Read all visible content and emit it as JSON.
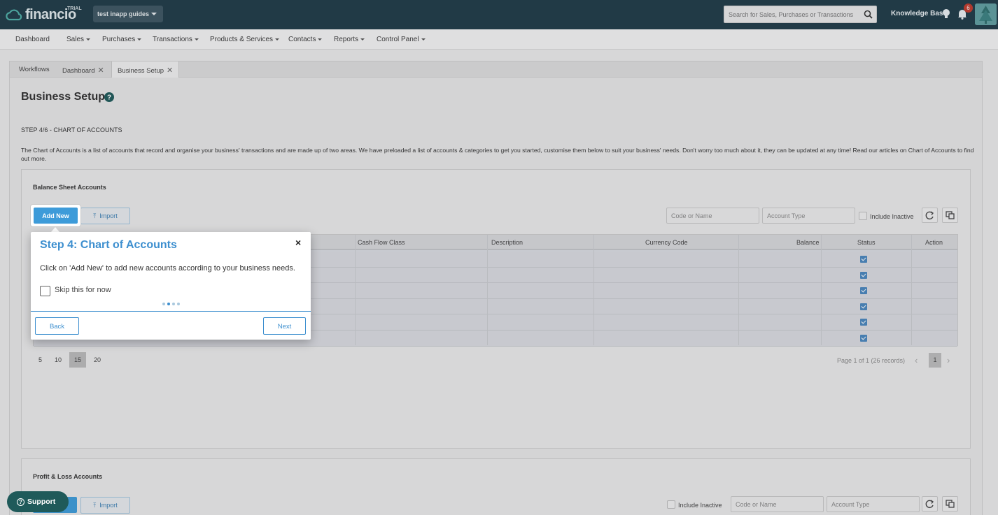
{
  "brand": {
    "logo_text": "financio",
    "trial_label": "TRIAL"
  },
  "org": {
    "name": "test inapp guides"
  },
  "search": {
    "placeholder": "Search for Sales, Purchases or Transactions"
  },
  "top_right": {
    "knowledge_base": "Knowledge Base",
    "notification_count": "6"
  },
  "nav": [
    "Dashboard",
    "Sales",
    "Purchases",
    "Transactions",
    "Products & Services",
    "Contacts",
    "Reports",
    "Control Panel"
  ],
  "tabs": [
    {
      "label": "Workflows",
      "closable": false
    },
    {
      "label": "Dashboard",
      "closable": true
    },
    {
      "label": "Business Setup",
      "closable": true
    }
  ],
  "page": {
    "title": "Business Setup",
    "step": "STEP 4/6 - CHART OF ACCOUNTS",
    "description": "The Chart of Accounts is a list of accounts that record and organise your business' transactions and are made up of two areas. We have preloaded a list of accounts & categories to get you started, customise them below to suit your business' needs. Don't worry too much about it, they can be updated at any time! Read our articles on Chart of Accounts to find out more."
  },
  "balance_sheet": {
    "title": "Balance Sheet Accounts",
    "add_new": "Add New",
    "import": "Import",
    "code_placeholder": "Code or Name",
    "type_placeholder": "Account Type",
    "include_inactive": "Include Inactive",
    "columns": [
      "Cash Flow Class",
      "Description",
      "Currency Code",
      "Balance",
      "Status",
      "Action"
    ],
    "row_count_visible": 6,
    "page_sizes": [
      "5",
      "10",
      "15",
      "20"
    ],
    "selected_page_size": "15",
    "page_info": "Page 1 of 1 (26 records)",
    "current_page": "1"
  },
  "profit_loss": {
    "title": "Profit & Loss Accounts",
    "import": "Import",
    "include_inactive": "Include Inactive",
    "code_placeholder": "Code or Name",
    "type_placeholder": "Account Type"
  },
  "guide": {
    "title": "Step 4: Chart of Accounts",
    "text": "Click on 'Add New' to add new accounts according to your business needs.",
    "skip_label": "Skip this for now",
    "back": "Back",
    "next": "Next",
    "close": "×",
    "steps_total": 4,
    "step_current": 2
  },
  "support": {
    "label": "Support"
  },
  "colors": {
    "topbar": "#1f3a47",
    "accent": "#3d8fcf",
    "primary_button": "#3d9bd9",
    "badge": "#c0392b"
  }
}
